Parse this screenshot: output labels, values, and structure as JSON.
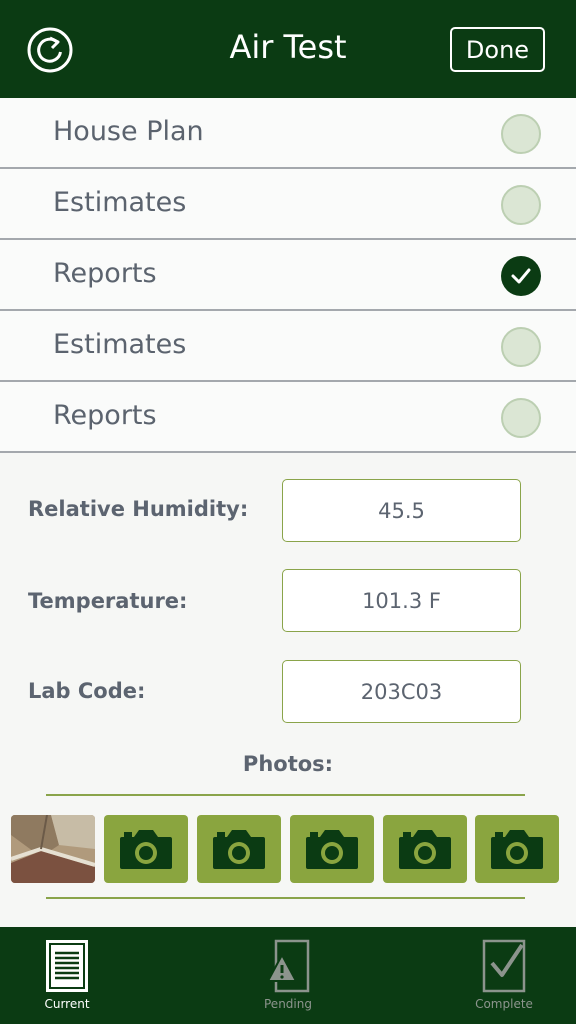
{
  "header": {
    "title": "Air Test",
    "done_label": "Done",
    "refresh_icon": "refresh-icon"
  },
  "checklist": [
    {
      "label": "House Plan",
      "checked": false
    },
    {
      "label": "Estimates",
      "checked": false
    },
    {
      "label": "Reports",
      "checked": true
    },
    {
      "label": "Estimates",
      "checked": false
    },
    {
      "label": "Reports",
      "checked": false
    }
  ],
  "fields": {
    "humidity": {
      "label": "Relative Humidity:",
      "value": "45.5"
    },
    "temperature": {
      "label": "Temperature:",
      "value": "101.3 F"
    },
    "lab_code": {
      "label": "Lab Code:",
      "value": "203C03"
    }
  },
  "photos": {
    "label": "Photos:",
    "slots": [
      "photo-thumbnail",
      "camera-icon",
      "camera-icon",
      "camera-icon",
      "camera-icon",
      "camera-icon"
    ]
  },
  "tabbar": {
    "tabs": [
      {
        "label": "Current",
        "icon": "document-icon",
        "active": true
      },
      {
        "label": "Pending",
        "icon": "warning-document-icon",
        "active": false
      },
      {
        "label": "Complete",
        "icon": "checked-document-icon",
        "active": false
      }
    ]
  },
  "colors": {
    "primary_dark_green": "#0b3b13",
    "accent_green": "#8aa53f",
    "unchecked_circle": "#dbe6d4",
    "text_gray": "#5c6470"
  }
}
